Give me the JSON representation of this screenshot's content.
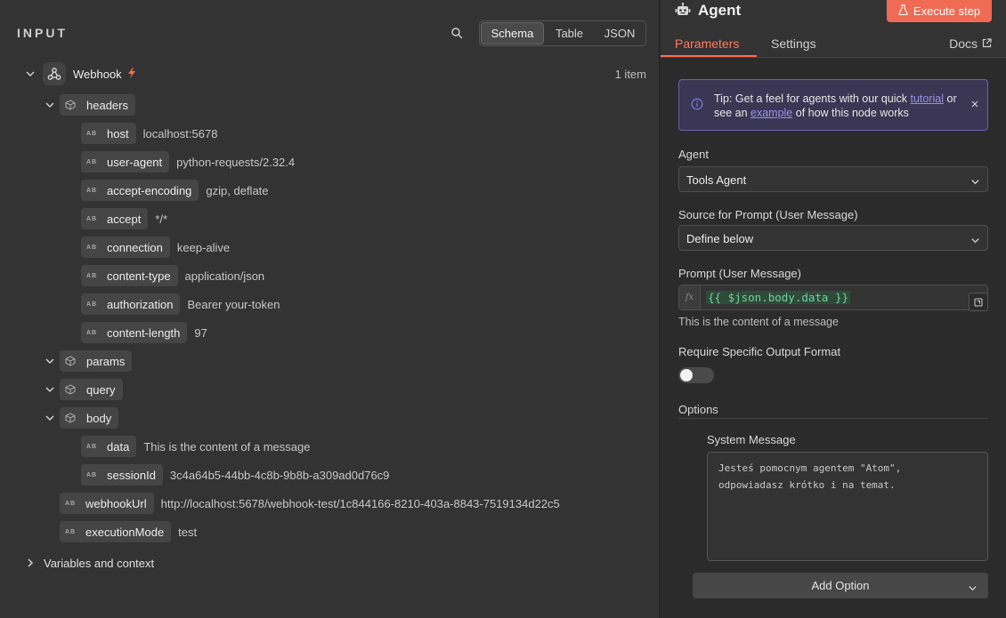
{
  "input_panel": {
    "title": "INPUT",
    "view_tabs": [
      "Schema",
      "Table",
      "JSON"
    ],
    "active_view": "Schema",
    "node_name": "Webhook",
    "item_count": "1 item",
    "fields": {
      "headers": {
        "name": "headers",
        "children": [
          {
            "name": "host",
            "value": "localhost:5678"
          },
          {
            "name": "user-agent",
            "value": "python-requests/2.32.4"
          },
          {
            "name": "accept-encoding",
            "value": "gzip, deflate"
          },
          {
            "name": "accept",
            "value": "*/*"
          },
          {
            "name": "connection",
            "value": "keep-alive"
          },
          {
            "name": "content-type",
            "value": "application/json"
          },
          {
            "name": "authorization",
            "value": "Bearer your-token"
          },
          {
            "name": "content-length",
            "value": "97"
          }
        ]
      },
      "params": {
        "name": "params"
      },
      "query": {
        "name": "query"
      },
      "body": {
        "name": "body",
        "children": [
          {
            "name": "data",
            "value": "This is the content of a message"
          },
          {
            "name": "sessionId",
            "value": "3c4a64b5-44bb-4c8b-9b8b-a309ad0d76c9"
          }
        ]
      },
      "webhookUrl": {
        "name": "webhookUrl",
        "value": "http://localhost:5678/webhook-test/1c844166-8210-403a-8843-7519134d22c5"
      },
      "executionMode": {
        "name": "executionMode",
        "value": "test"
      }
    },
    "type_badge": "AB",
    "variables_label": "Variables and context"
  },
  "node_panel": {
    "title": "Agent",
    "execute_label": "Execute step",
    "tabs": {
      "parameters": "Parameters",
      "settings": "Settings",
      "docs": "Docs"
    },
    "tip": {
      "prefix": "Tip: Get a feel for agents with our quick",
      "link1": "tutorial",
      "middle": "or see an",
      "link2": "example",
      "suffix": "of how this node works"
    },
    "agent_label": "Agent",
    "agent_value": "Tools Agent",
    "source_label": "Source for Prompt (User Message)",
    "source_value": "Define below",
    "prompt_label": "Prompt (User Message)",
    "prompt_fx": "fx",
    "prompt_value": "{{ $json.body.data }}",
    "prompt_hint": "This is the content of a message",
    "output_format_label": "Require Specific Output Format",
    "output_format_enabled": false,
    "options_label": "Options",
    "system_message_label": "System Message",
    "system_message_value": "Jesteś pomocnym agentem \"Atom\",\nodpowiadasz krótko i na temat.",
    "add_option_label": "Add Option"
  },
  "colors": {
    "accent": "#ff6d4d",
    "execute_bg": "#ef6b53",
    "tip_border": "#6b61b5",
    "expression_green": "#6fd39a"
  }
}
